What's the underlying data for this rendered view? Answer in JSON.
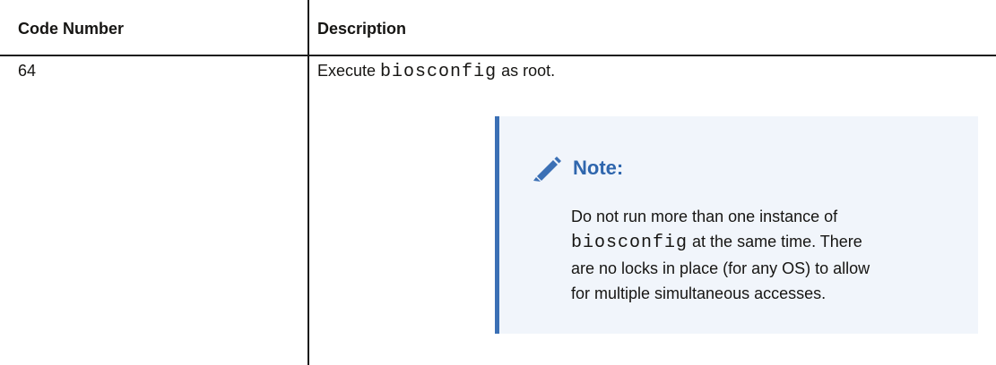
{
  "table": {
    "headers": {
      "code": "Code Number",
      "description": "Description"
    },
    "rows": [
      {
        "code": "64",
        "description": {
          "prefix": "Execute ",
          "command": "biosconfig",
          "suffix": " as root."
        }
      }
    ]
  },
  "note": {
    "icon": "pencil-icon",
    "title": "Note:",
    "line1": "Do not run more than one instance of",
    "line2_command": "biosconfig",
    "line2_suffix": " at the same time. There",
    "line3": "are no locks in place (for any OS) to allow",
    "line4": "for multiple simultaneous accesses."
  },
  "colors": {
    "accent": "#3b70b5",
    "note_background": "#f1f5fb",
    "note_title": "#2f66ad"
  }
}
